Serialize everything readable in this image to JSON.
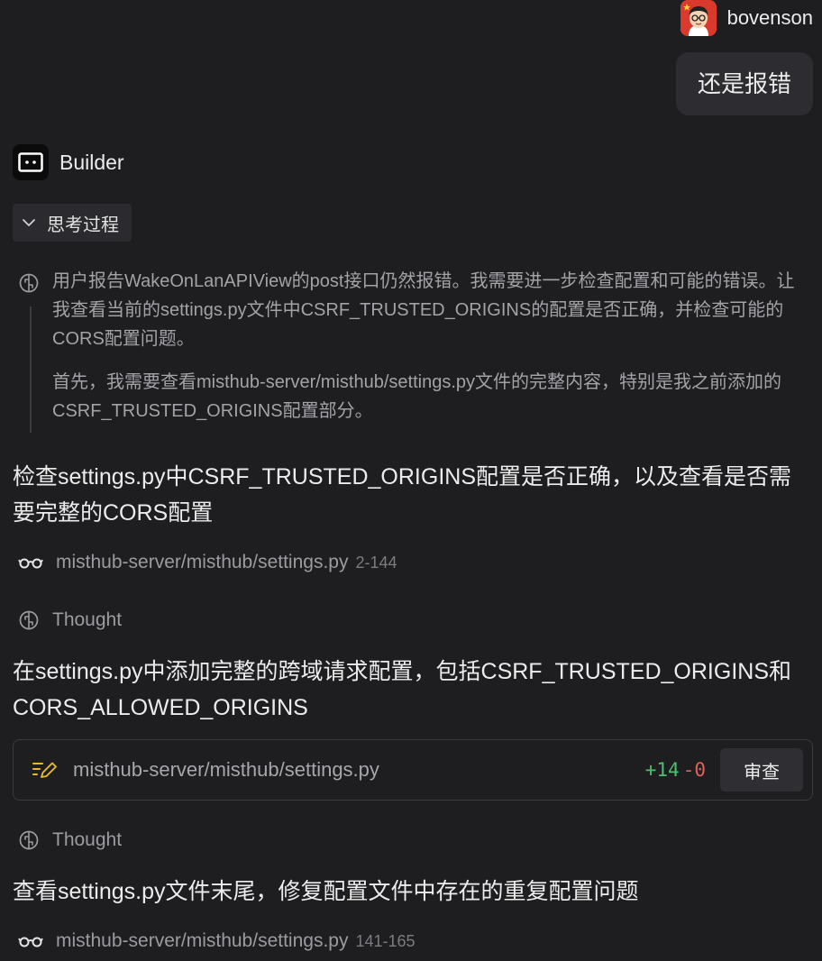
{
  "user": {
    "name": "bovenson",
    "message": "还是报错"
  },
  "bot": {
    "name": "Builder"
  },
  "thinking": {
    "toggle_label": "思考过程",
    "paragraph1": "用户报告WakeOnLanAPIView的post接口仍然报错。我需要进一步检查配置和可能的错误。让我查看当前的settings.py文件中CSRF_TRUSTED_ORIGINS的配置是否正确，并检查可能的CORS配置问题。",
    "paragraph2": "首先，我需要查看misthub-server/misthub/settings.py文件的完整内容，特别是我之前添加的CSRF_TRUSTED_ORIGINS配置部分。"
  },
  "steps": [
    {
      "text": "检查settings.py中CSRF_TRUSTED_ORIGINS配置是否正确，以及查看是否需要完整的CORS配置",
      "file": "misthub-server/misthub/settings.py",
      "range": "2-144"
    },
    {
      "thought": "Thought",
      "text": "在settings.py中添加完整的跨域请求配置，包括CSRF_TRUSTED_ORIGINS和CORS_ALLOWED_ORIGINS",
      "edit": {
        "file": "misthub-server/misthub/settings.py",
        "added": "+14",
        "removed": "-0",
        "review_label": "审查"
      }
    },
    {
      "thought": "Thought",
      "text": "查看settings.py文件末尾，修复配置文件中存在的重复配置问题",
      "file": "misthub-server/misthub/settings.py",
      "range": "141-165"
    }
  ],
  "colors": {
    "background": "#1e1e21",
    "diff_add": "#4fbf6e",
    "diff_remove": "#e0605a",
    "edit_icon": "#e8b931"
  }
}
